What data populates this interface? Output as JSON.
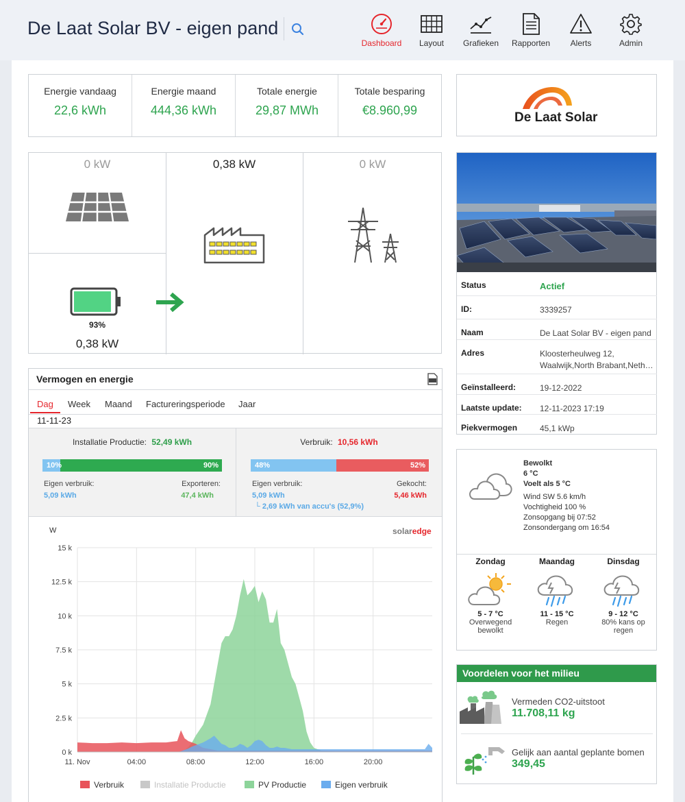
{
  "header": {
    "title": "De Laat Solar BV - eigen pand",
    "nav": [
      {
        "label": "Dashboard",
        "icon": "dashboard-gauge-icon",
        "active": true
      },
      {
        "label": "Layout",
        "icon": "layout-grid-icon"
      },
      {
        "label": "Grafieken",
        "icon": "chart-line-icon"
      },
      {
        "label": "Rapporten",
        "icon": "report-document-icon"
      },
      {
        "label": "Alerts",
        "icon": "alert-triangle-icon"
      },
      {
        "label": "Admin",
        "icon": "gear-icon"
      }
    ]
  },
  "kpis": [
    {
      "label": "Energie vandaag",
      "value": "22,6 kWh"
    },
    {
      "label": "Energie maand",
      "value": "444,36 kWh"
    },
    {
      "label": "Totale energie",
      "value": "29,87 MWh"
    },
    {
      "label": "Totale besparing",
      "value": "€8.960,99"
    }
  ],
  "flow": {
    "pv_power": "0 kW",
    "consumption_power": "0,38 kW",
    "grid_power": "0 kW",
    "battery_percent": "93%",
    "battery_power": "0,38 kW",
    "battery_level": 0.93
  },
  "logo": {
    "text": "De Laat Solar"
  },
  "site_info": {
    "rows": [
      {
        "key": "Status",
        "value": "Actief"
      },
      {
        "key": "ID:",
        "value": "3339257"
      },
      {
        "key": "Naam",
        "value": "De Laat Solar BV - eigen pand"
      },
      {
        "key": "Adres",
        "value": "Kloosterheulweg 12, Waalwijk,North Brabant,Neth…"
      },
      {
        "key": "Geïnstalleerd:",
        "value": "19-12-2022"
      },
      {
        "key": "Laatste update:",
        "value": "12-11-2023 17:19"
      },
      {
        "key": "Piekvermogen",
        "value": "45,1 kWp"
      }
    ]
  },
  "energy_panel": {
    "title": "Vermogen en energie",
    "tabs": [
      "Dag",
      "Week",
      "Maand",
      "Factureringsperiode",
      "Jaar"
    ],
    "active_tab": "Dag",
    "date": "11-11-23",
    "production": {
      "label": "Installatie Productie:",
      "value": "52,49 kWh",
      "self_pct_label": "10%",
      "export_pct_label": "90%",
      "self_fraction": 0.1,
      "self_label": "Eigen verbruik:",
      "self_value": "5,09 kWh",
      "export_label": "Exporteren:",
      "export_value": "47,4 kWh"
    },
    "consumption": {
      "label": "Verbruik:",
      "value": "10,56 kWh",
      "self_pct_label": "48%",
      "bought_pct_label": "52%",
      "self_fraction": 0.48,
      "self_label": "Eigen verbruik:",
      "self_value": "5,09 kWh",
      "battery_note": "└ 2,69 kWh van accu's (52,9%)",
      "bought_label": "Gekocht:",
      "bought_value": "5,46 kWh"
    }
  },
  "chart_data": {
    "type": "area",
    "ylabel": "W",
    "ylim": [
      0,
      15000
    ],
    "y_ticks": [
      "0 k",
      "2.5 k",
      "5 k",
      "7.5 k",
      "10 k",
      "12.5 k",
      "15 k"
    ],
    "x_ticks": [
      "11. Nov",
      "04:00",
      "08:00",
      "12:00",
      "16:00",
      "20:00"
    ],
    "brand": {
      "prefix": "solar",
      "suffix": "edge"
    },
    "x_hours": [
      0,
      1,
      2,
      3,
      4,
      5,
      6,
      6.75,
      7,
      7.25,
      7.5,
      7.75,
      8,
      8.5,
      9,
      9.25,
      9.5,
      9.75,
      10,
      10.25,
      10.5,
      10.75,
      11,
      11.25,
      11.5,
      11.75,
      12,
      12.25,
      12.5,
      12.75,
      13,
      13.25,
      13.5,
      13.75,
      14,
      14.25,
      14.5,
      14.75,
      15,
      15.25,
      15.5,
      15.75,
      16,
      16.5,
      17,
      18,
      19,
      20,
      21,
      22,
      23,
      23.5,
      23.75,
      24
    ],
    "series": [
      {
        "name": "Verbruik",
        "color": "#e8535a",
        "values": [
          700,
          650,
          650,
          700,
          650,
          700,
          700,
          800,
          1600,
          1000,
          800,
          700,
          600,
          300,
          200,
          150,
          100,
          100,
          100,
          100,
          100,
          100,
          100,
          100,
          100,
          100,
          100,
          100,
          100,
          100,
          100,
          100,
          100,
          100,
          100,
          100,
          100,
          100,
          100,
          100,
          100,
          100,
          100,
          100,
          100,
          100,
          100,
          100,
          100,
          100,
          100,
          100,
          100,
          100
        ]
      },
      {
        "name": "Installatie Productie",
        "color": "#c8c8c8",
        "disabled": true,
        "values": []
      },
      {
        "name": "PV Productie",
        "color": "#8dd49a",
        "values": [
          0,
          0,
          0,
          0,
          0,
          0,
          0,
          0,
          50,
          150,
          350,
          700,
          1200,
          2000,
          3500,
          5000,
          6500,
          8000,
          8500,
          8500,
          9000,
          10000,
          11500,
          12700,
          11500,
          11800,
          12200,
          11000,
          11800,
          11200,
          9500,
          9500,
          10500,
          8000,
          7500,
          6500,
          5500,
          5000,
          4000,
          3000,
          1500,
          700,
          300,
          100,
          50,
          0,
          0,
          0,
          0,
          0,
          0,
          0,
          0,
          0
        ]
      },
      {
        "name": "Eigen verbruik",
        "color": "#6aacee",
        "values": [
          0,
          0,
          0,
          0,
          0,
          0,
          0,
          0,
          50,
          150,
          250,
          400,
          500,
          700,
          1000,
          1200,
          900,
          600,
          500,
          300,
          300,
          400,
          600,
          500,
          300,
          500,
          800,
          900,
          800,
          500,
          300,
          300,
          400,
          300,
          300,
          250,
          200,
          200,
          200,
          200,
          200,
          200,
          200,
          200,
          200,
          200,
          200,
          200,
          200,
          200,
          200,
          200,
          600,
          300
        ]
      }
    ]
  },
  "weather": {
    "condition": "Bewolkt",
    "temp": "6 °C",
    "feels": "Voelt als 5 °C",
    "wind": "Wind SW 5.6 km/h",
    "humidity": "Vochtigheid 100 %",
    "sunrise": "Zonsopgang bij 07:52",
    "sunset": "Zonsondergang om 16:54",
    "forecast": [
      {
        "day": "Zondag",
        "icon": "partly-cloudy-icon",
        "temp": "5 - 7 °C",
        "desc": "Overwegend bewolkt"
      },
      {
        "day": "Maandag",
        "icon": "rain-thunder-icon",
        "temp": "11 - 15 °C",
        "desc": "Regen"
      },
      {
        "day": "Dinsdag",
        "icon": "rain-thunder-icon",
        "temp": "9 - 12 °C",
        "desc": "80% kans op regen"
      }
    ]
  },
  "env": {
    "title": "Voordelen voor het milieu",
    "co2_label": "Vermeden CO2-uitstoot",
    "co2_value": "11.708,11 kg",
    "trees_label": "Gelijk aan aantal geplante bomen",
    "trees_value": "349,45"
  },
  "colors": {
    "accent_red": "#e5262c",
    "green": "#2ea44f",
    "env_green": "#2f9a4b",
    "blue_light": "#82c4f1",
    "bar_green": "#2eaa50",
    "bar_red": "#e95c5f"
  }
}
